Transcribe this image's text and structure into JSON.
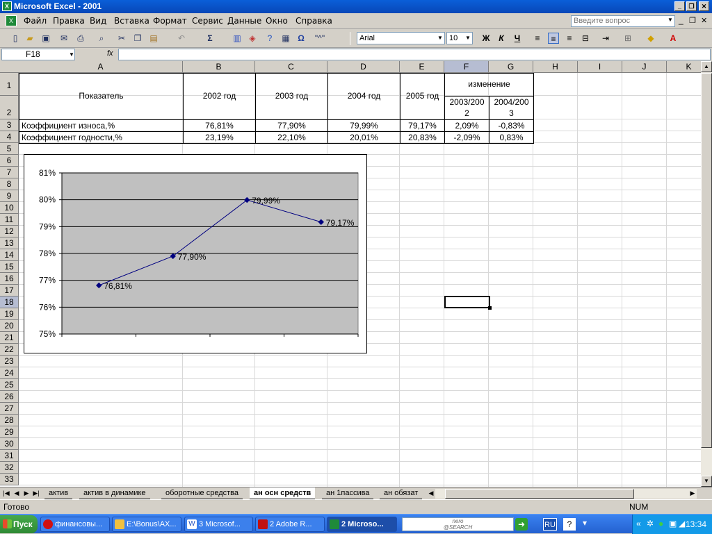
{
  "window": {
    "title": "Microsoft Excel - 2001",
    "minimize": "_",
    "restore": "❐",
    "close": "✕"
  },
  "menu": {
    "items": [
      "Файл",
      "Правка",
      "Вид",
      "Вставка",
      "Формат",
      "Сервис",
      "Данные",
      "Окно",
      "Справка"
    ],
    "ask_placeholder": "Введите вопрос",
    "doc_min": "_",
    "doc_restore": "❐",
    "doc_close": "✕"
  },
  "toolbar": {
    "font_name": "Arial",
    "font_size": "10",
    "bold_label": "Ж",
    "italic_label": "К",
    "underline_label": "Ч",
    "autosum_label": "Σ",
    "omega_label": "Ω",
    "symbol_label": "\"^\""
  },
  "formula_bar": {
    "cell_ref": "F18",
    "fx_label": "fx",
    "value": ""
  },
  "columns": [
    "A",
    "B",
    "C",
    "D",
    "E",
    "F",
    "G",
    "H",
    "I",
    "J",
    "K"
  ],
  "rows": [
    "1",
    "2",
    "3",
    "4",
    "5",
    "6",
    "7",
    "8",
    "9",
    "10",
    "11",
    "12",
    "13",
    "14",
    "15",
    "16",
    "17",
    "18",
    "19",
    "20",
    "21",
    "22",
    "23",
    "24",
    "25",
    "26",
    "27",
    "28",
    "29",
    "30",
    "31",
    "32",
    "33"
  ],
  "table": {
    "header_indicator": "Показатель",
    "years": [
      "2002 год",
      "2003 год",
      "2004 год",
      "2005 год"
    ],
    "change_header": "изменение",
    "change_sub": [
      [
        "2003/200",
        "2"
      ],
      [
        "2004/200",
        "3"
      ]
    ],
    "rows": [
      {
        "label": "Коэффициент износа,%",
        "values": [
          "76,81%",
          "77,90%",
          "79,99%",
          "79,17%"
        ],
        "changes": [
          "2,09%",
          "-0,83%"
        ]
      },
      {
        "label": "Коэффициент годности,%",
        "values": [
          "23,19%",
          "22,10%",
          "20,01%",
          "20,83%"
        ],
        "changes": [
          "-2,09%",
          "0,83%"
        ]
      }
    ]
  },
  "chart_data": {
    "type": "line",
    "title": "",
    "xlabel": "",
    "ylabel": "",
    "categories": [
      "",
      "",
      "",
      ""
    ],
    "series": [
      {
        "values": [
          76.81,
          77.9,
          79.99,
          79.17
        ],
        "color": "#000080"
      }
    ],
    "data_labels": [
      "76,81%",
      "77,90%",
      "79,99%",
      "79,17%"
    ],
    "ylim": [
      75,
      81
    ],
    "yticks": [
      "75%",
      "76%",
      "77%",
      "78%",
      "79%",
      "80%",
      "81%"
    ],
    "plot_background": "#c0c0c0",
    "grid": true,
    "legend": "none"
  },
  "sheet_tabs": {
    "items": [
      "актив",
      "актив в динамике",
      "оборотные средства",
      "ан осн средств",
      "ан 1пассива",
      "ан обязат"
    ],
    "active": "ан осн средств"
  },
  "status": {
    "left": "Готово",
    "num": "NUM"
  },
  "taskbar": {
    "start": "Пуск",
    "tasks": [
      "финансовы...",
      "E:\\Bonus\\AX...",
      "3 Microsof...",
      "2 Adobe R...",
      "2 Microso..."
    ],
    "nero_top": "nero",
    "nero_bottom": "@SEARCH",
    "lang": "RU",
    "clock": "13:34"
  },
  "colors": {
    "accent": "#0a5fd8",
    "excel_green": "#1f8a3a",
    "selection": "#b6bdd2"
  }
}
